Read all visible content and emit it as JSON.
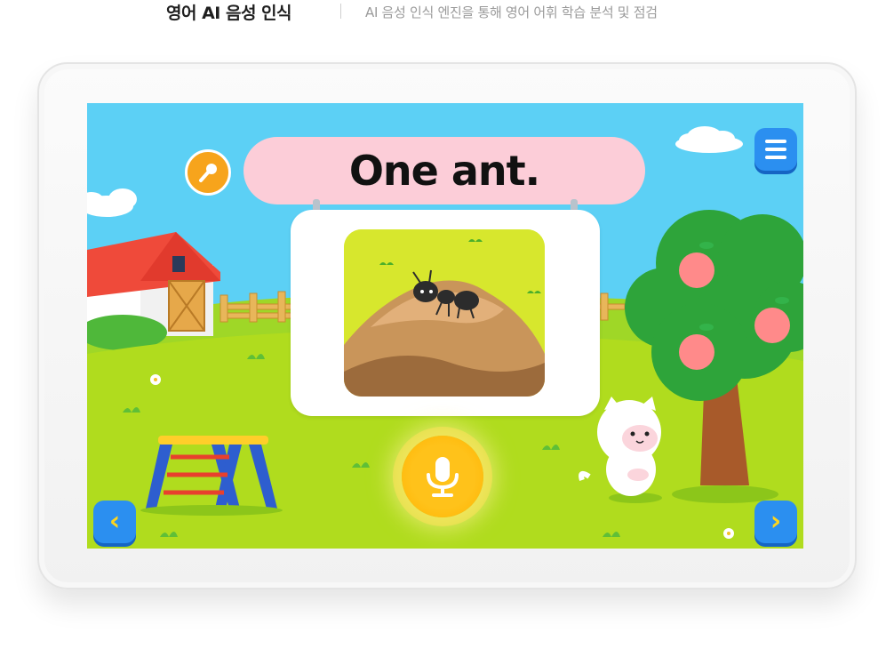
{
  "header": {
    "title": "영어 AI 음성 인식",
    "description": "AI 음성 인식 엔진을 통해 영어 어휘 학습 분석 및 점검"
  },
  "lesson": {
    "sentence": "One ant."
  },
  "icons": {
    "small_mic": "microphone-icon",
    "menu": "hamburger-menu-icon",
    "prev": "chevron-left-icon",
    "next": "chevron-right-icon",
    "record": "microphone-icon"
  },
  "colors": {
    "sky": "#5cd0f5",
    "grass": "#9fd727",
    "pill": "#fccdd8",
    "button_blue": "#2b8ff0",
    "accent_yellow": "#ffc21a",
    "orange": "#f7a41c"
  }
}
